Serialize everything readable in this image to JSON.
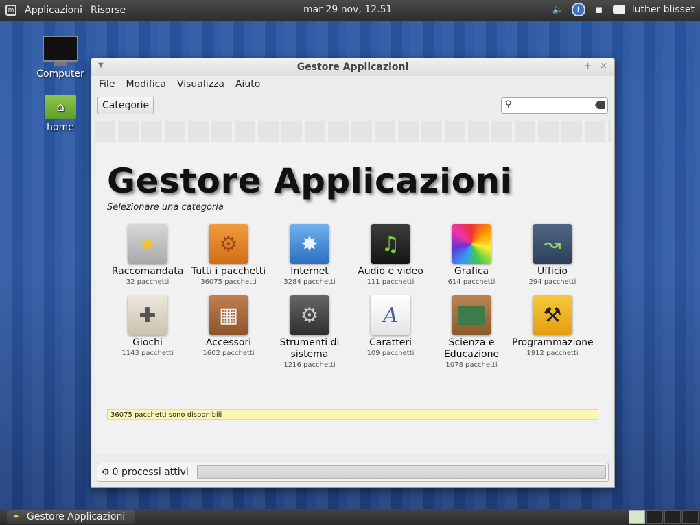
{
  "top_panel": {
    "menu_applications": "Applicazioni",
    "menu_places": "Risorse",
    "clock": "mar 29 nov, 12.51",
    "user": "luther blisset",
    "tray_icons": [
      "volume-icon",
      "update-shield-icon",
      "network-icon",
      "chat-icon"
    ]
  },
  "desktop": {
    "icons": [
      {
        "label": "Computer",
        "icon": "monitor-icon"
      },
      {
        "label": "home",
        "icon": "home-folder-icon"
      }
    ]
  },
  "window": {
    "title": "Gestore Applicazioni",
    "controls": [
      "–",
      "+",
      "×"
    ],
    "menu": [
      "File",
      "Modifica",
      "Visualizza",
      "Aiuto"
    ],
    "toolbar": {
      "categories_button": "Categorie",
      "search_value": ""
    },
    "heading": "Gestore Applicazioni",
    "subheading": "Selezionare una categoria",
    "categories": [
      {
        "name": "Raccomandata",
        "count": "32 pacchetti",
        "icon": "star-icon",
        "color": "#b9b9b9"
      },
      {
        "name": "Tutti i pacchetti",
        "count": "36075 pacchetti",
        "icon": "gears-icon",
        "color": "#e8842a"
      },
      {
        "name": "Internet",
        "count": "3284 pacchetti",
        "icon": "globe-icon",
        "color": "#3f86d6"
      },
      {
        "name": "Audio e video",
        "count": "111 pacchetti",
        "icon": "clapper-music-icon",
        "color": "#2b2b2b"
      },
      {
        "name": "Grafica",
        "count": "614 pacchetti",
        "icon": "color-wheel-icon",
        "color": "#d84aa0"
      },
      {
        "name": "Ufficio",
        "count": "294 pacchetti",
        "icon": "chart-icon",
        "color": "#3a4f6e"
      },
      {
        "name": "Giochi",
        "count": "1143 pacchetti",
        "icon": "gamepad-icon",
        "color": "#d9d4c4"
      },
      {
        "name": "Accessori",
        "count": "1602 pacchetti",
        "icon": "calculator-icon",
        "color": "#a86a3a"
      },
      {
        "name": "Strumenti di sistema",
        "count": "1216 pacchetti",
        "icon": "system-gear-icon",
        "color": "#4a4a4a"
      },
      {
        "name": "Caratteri",
        "count": "109 pacchetti",
        "icon": "font-icon",
        "color": "#f7f7f7"
      },
      {
        "name": "Scienza e Educazione",
        "count": "1078 pacchetti",
        "icon": "chalkboard-icon",
        "color": "#a8723f"
      },
      {
        "name": "Programmazione",
        "count": "1912 pacchetti",
        "icon": "construction-icon",
        "color": "#f0b21c"
      }
    ],
    "status_message": "36075 pacchetti sono disponibili",
    "footer_status": "0 processi attivi"
  },
  "bottom_panel": {
    "task_label": "Gestore Applicazioni",
    "workspaces": 4
  }
}
